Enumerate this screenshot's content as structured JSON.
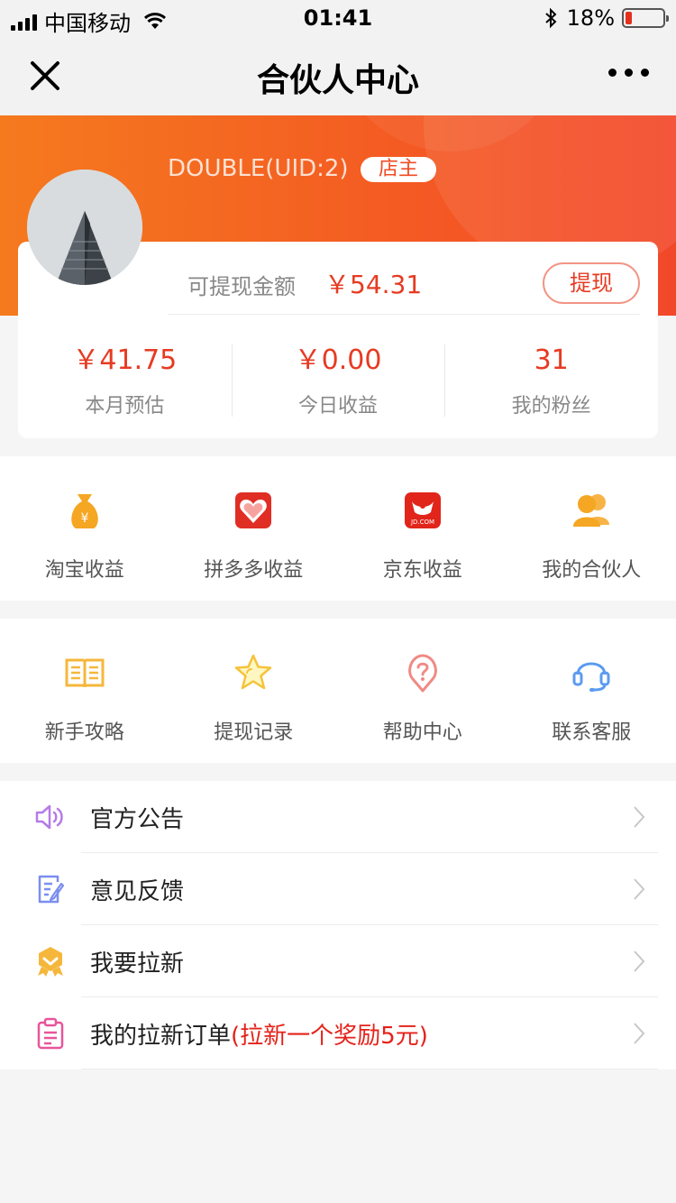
{
  "status_bar": {
    "carrier": "中国移动",
    "time": "01:41",
    "battery": "18%",
    "battery_level": 0.18
  },
  "nav": {
    "title": "合伙人中心"
  },
  "user": {
    "uid_text": "DOUBLE(UID:2)",
    "role": "店主"
  },
  "balance": {
    "label": "可提现金额",
    "value": "￥54.31",
    "withdraw_label": "提现"
  },
  "stats": [
    {
      "value": "￥41.75",
      "label": "本月预估"
    },
    {
      "value": "￥0.00",
      "label": "今日收益"
    },
    {
      "value": "31",
      "label": "我的粉丝"
    }
  ],
  "earnings_grid": [
    {
      "label": "淘宝收益",
      "icon": "taobao-moneybag-icon"
    },
    {
      "label": "拼多多收益",
      "icon": "pinduoduo-icon"
    },
    {
      "label": "京东收益",
      "icon": "jd-icon"
    },
    {
      "label": "我的合伙人",
      "icon": "partners-icon"
    }
  ],
  "tools_grid": [
    {
      "label": "新手攻略",
      "icon": "book-icon"
    },
    {
      "label": "提现记录",
      "icon": "star-icon"
    },
    {
      "label": "帮助中心",
      "icon": "help-icon"
    },
    {
      "label": "联系客服",
      "icon": "headset-icon"
    }
  ],
  "menu": [
    {
      "label": "官方公告",
      "extra": "",
      "icon": "speaker-icon"
    },
    {
      "label": "意见反馈",
      "extra": "",
      "icon": "feedback-icon"
    },
    {
      "label": "我要拉新",
      "extra": "",
      "icon": "medal-icon"
    },
    {
      "label": "我的拉新订单",
      "extra": "(拉新一个奖励5元)",
      "icon": "clipboard-icon"
    }
  ],
  "colors": {
    "accent": "#f45a23",
    "price": "#e63b22",
    "jd_red": "#e1251b",
    "pdd_red": "#e02e24",
    "gold": "#f5a623"
  }
}
